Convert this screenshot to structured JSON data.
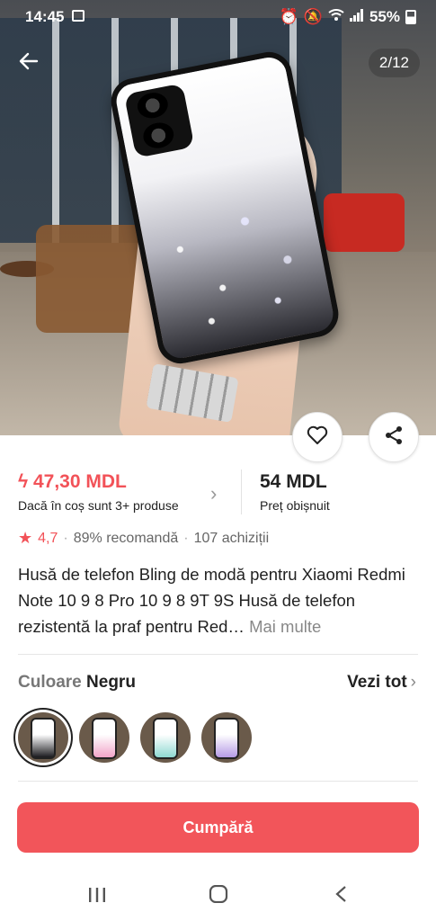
{
  "status_bar": {
    "time": "14:45",
    "battery": "55%"
  },
  "gallery": {
    "counter": "2/12"
  },
  "price": {
    "promo_icon": "lightning-icon",
    "promo_price": "47,30 MDL",
    "promo_condition": "Dacă în coș sunt 3+ produse",
    "regular_price": "54 MDL",
    "regular_label": "Preț obișnuit"
  },
  "rating": {
    "score": "4,7",
    "recommend": "89% recomandă",
    "purchases": "107 achiziții"
  },
  "product": {
    "title": "Husă de telefon Bling de modă pentru Xiaomi Redmi Note 10 9 8 Pro 10 9 8 9T 9S Husă de telefon rezistentă la praf pentru Red…",
    "more": "Mai multe"
  },
  "variant": {
    "label": "Culoare",
    "value": "Negru",
    "see_all": "Vezi tot",
    "swatch_colors": [
      "#1b1b1f",
      "#f1a4c8",
      "#8fd9d2",
      "#b59be6"
    ]
  },
  "buy_button": "Cumpără",
  "colors": {
    "accent": "#f2555a",
    "price_red": "#f25258"
  }
}
